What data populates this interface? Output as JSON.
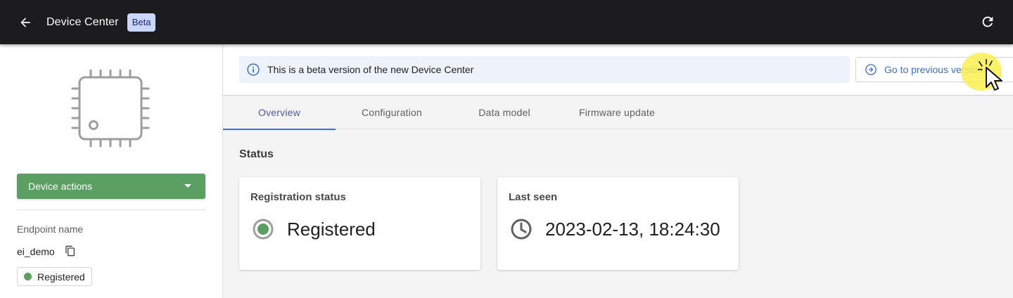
{
  "topbar": {
    "title": "Device Center",
    "badge": "Beta",
    "back_icon": "arrow-left-icon",
    "refresh_icon": "refresh-icon"
  },
  "sidebar": {
    "device_icon": "chip-icon",
    "actions_label": "Device actions",
    "endpoint_label": "Endpoint name",
    "endpoint_value": "ei_demo",
    "copy_icon": "copy-icon",
    "status_chip": "Registered"
  },
  "banner": {
    "message": "This is a beta version of the new Device Center",
    "prev_button": "Go to previous version"
  },
  "tabs": [
    {
      "label": "Overview",
      "active": true
    },
    {
      "label": "Configuration",
      "active": false
    },
    {
      "label": "Data model",
      "active": false
    },
    {
      "label": "Firmware update",
      "active": false
    }
  ],
  "status": {
    "section_title": "Status",
    "cards": [
      {
        "title": "Registration status",
        "value": "Registered",
        "icon": "radio-checked-icon"
      },
      {
        "title": "Last seen",
        "value": "2023-02-13, 18:24:30",
        "icon": "clock-icon"
      }
    ]
  },
  "colors": {
    "topbar_bg": "#1c1c1e",
    "accent_green": "#5b9f62",
    "link_blue": "#3b6fd8",
    "badge_bg": "#c9d7ff"
  }
}
